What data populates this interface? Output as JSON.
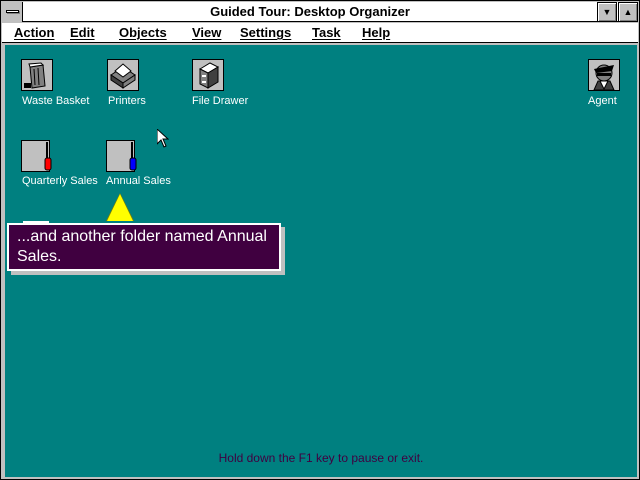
{
  "window": {
    "title": "Guided Tour: Desktop Organizer",
    "minimize_glyph": "▼",
    "maximize_glyph": "▲"
  },
  "menubar": {
    "items": [
      {
        "label": "Action"
      },
      {
        "label": "Edit"
      },
      {
        "label": "Objects"
      },
      {
        "label": "View"
      },
      {
        "label": "Settings"
      },
      {
        "label": "Task"
      },
      {
        "label": "Help"
      }
    ]
  },
  "desktop": {
    "background_color": "#008080",
    "icons": [
      {
        "label": "Waste Basket",
        "icon": "waste-basket-icon"
      },
      {
        "label": "Printers",
        "icon": "printer-icon"
      },
      {
        "label": "File Drawer",
        "icon": "file-drawer-icon"
      },
      {
        "label": "Agent",
        "icon": "agent-icon"
      },
      {
        "label": "Quarterly Sales",
        "icon": "folder-icon"
      },
      {
        "label": "Annual Sales",
        "icon": "folder-icon"
      }
    ]
  },
  "tour_tip": {
    "text": "...and another folder named Annual Sales.",
    "background_color": "#400040",
    "arrow_color": "#ffff00"
  },
  "status": {
    "text": "Hold down the F1 key to pause or exit."
  }
}
